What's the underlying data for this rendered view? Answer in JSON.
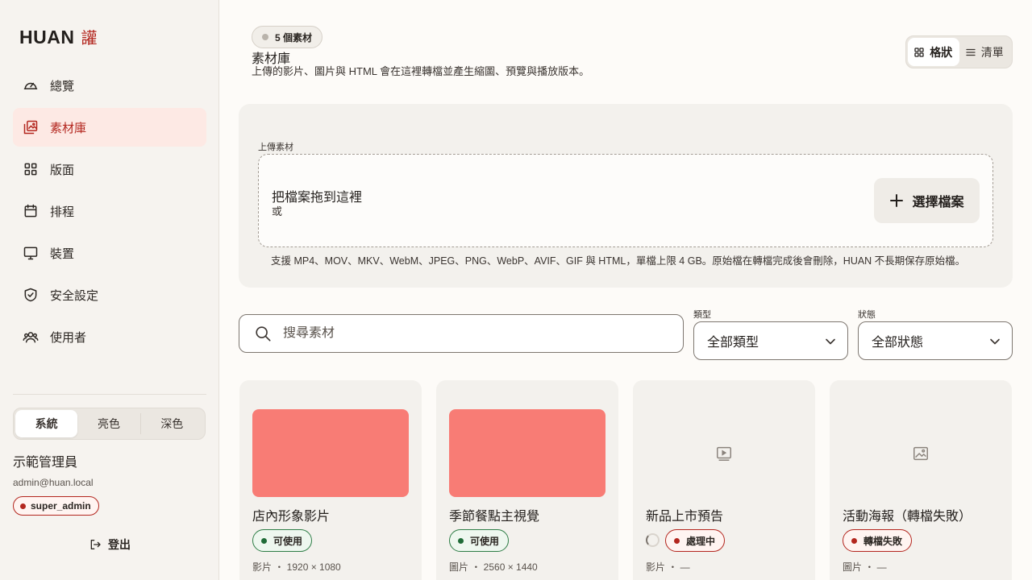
{
  "brand": {
    "name": "HUAN",
    "mark": "讙"
  },
  "nav": [
    {
      "key": "overview",
      "label": "總覽",
      "icon": "gauge-icon",
      "active": false
    },
    {
      "key": "library",
      "label": "素材庫",
      "icon": "image-library-icon",
      "active": true
    },
    {
      "key": "layout",
      "label": "版面",
      "icon": "grid-icon",
      "active": false
    },
    {
      "key": "schedule",
      "label": "排程",
      "icon": "calendar-icon",
      "active": false
    },
    {
      "key": "devices",
      "label": "裝置",
      "icon": "monitor-icon",
      "active": false
    },
    {
      "key": "security",
      "label": "安全設定",
      "icon": "shield-icon",
      "active": false
    },
    {
      "key": "users",
      "label": "使用者",
      "icon": "users-icon",
      "active": false
    }
  ],
  "theme": {
    "options": [
      "系統",
      "亮色",
      "深色"
    ],
    "selected": "系統"
  },
  "user": {
    "name": "示範管理員",
    "email": "admin@huan.local",
    "role": "super_admin"
  },
  "logout_label": "登出",
  "header": {
    "count_label": "5 個素材",
    "title": "素材庫",
    "description": "上傳的影片、圖片與 HTML 會在這裡轉檔並產生縮圖、預覽與播放版本。"
  },
  "view_toggle": {
    "grid_label": "格狀",
    "list_label": "清單",
    "selected": "grid"
  },
  "upload": {
    "label": "上傳素材",
    "drop_title": "把檔案拖到這裡",
    "drop_or": "或",
    "choose_label": "選擇檔案",
    "note": "支援 MP4、MOV、MKV、WebM、JPEG、PNG、WebP、AVIF、GIF 與 HTML，單檔上限 4 GB。原始檔在轉檔完成後會刪除，HUAN 不長期保存原始檔。"
  },
  "filters": {
    "search_placeholder": "搜尋素材",
    "type_label": "類型",
    "type_value": "全部類型",
    "status_label": "狀態",
    "status_value": "全部狀態"
  },
  "assets": [
    {
      "title": "店內形象影片",
      "status": "可使用",
      "status_kind": "ok",
      "meta": "影片 ・ 1920 × 1080",
      "thumb": "red"
    },
    {
      "title": "季節餐點主視覺",
      "status": "可使用",
      "status_kind": "ok",
      "meta": "圖片 ・ 2560 × 1440",
      "thumb": "red"
    },
    {
      "title": "新品上市預告",
      "status": "處理中",
      "status_kind": "proc",
      "meta": "影片 ・ —",
      "thumb": "video-icon"
    },
    {
      "title": "活動海報（轉檔失敗）",
      "status": "轉檔失敗",
      "status_kind": "fail",
      "meta": "圖片 ・ —",
      "thumb": "image-icon"
    }
  ],
  "colors": {
    "accent": "#b3261e",
    "ok": "#1f6b37",
    "thumb_red": "#f87c75"
  }
}
